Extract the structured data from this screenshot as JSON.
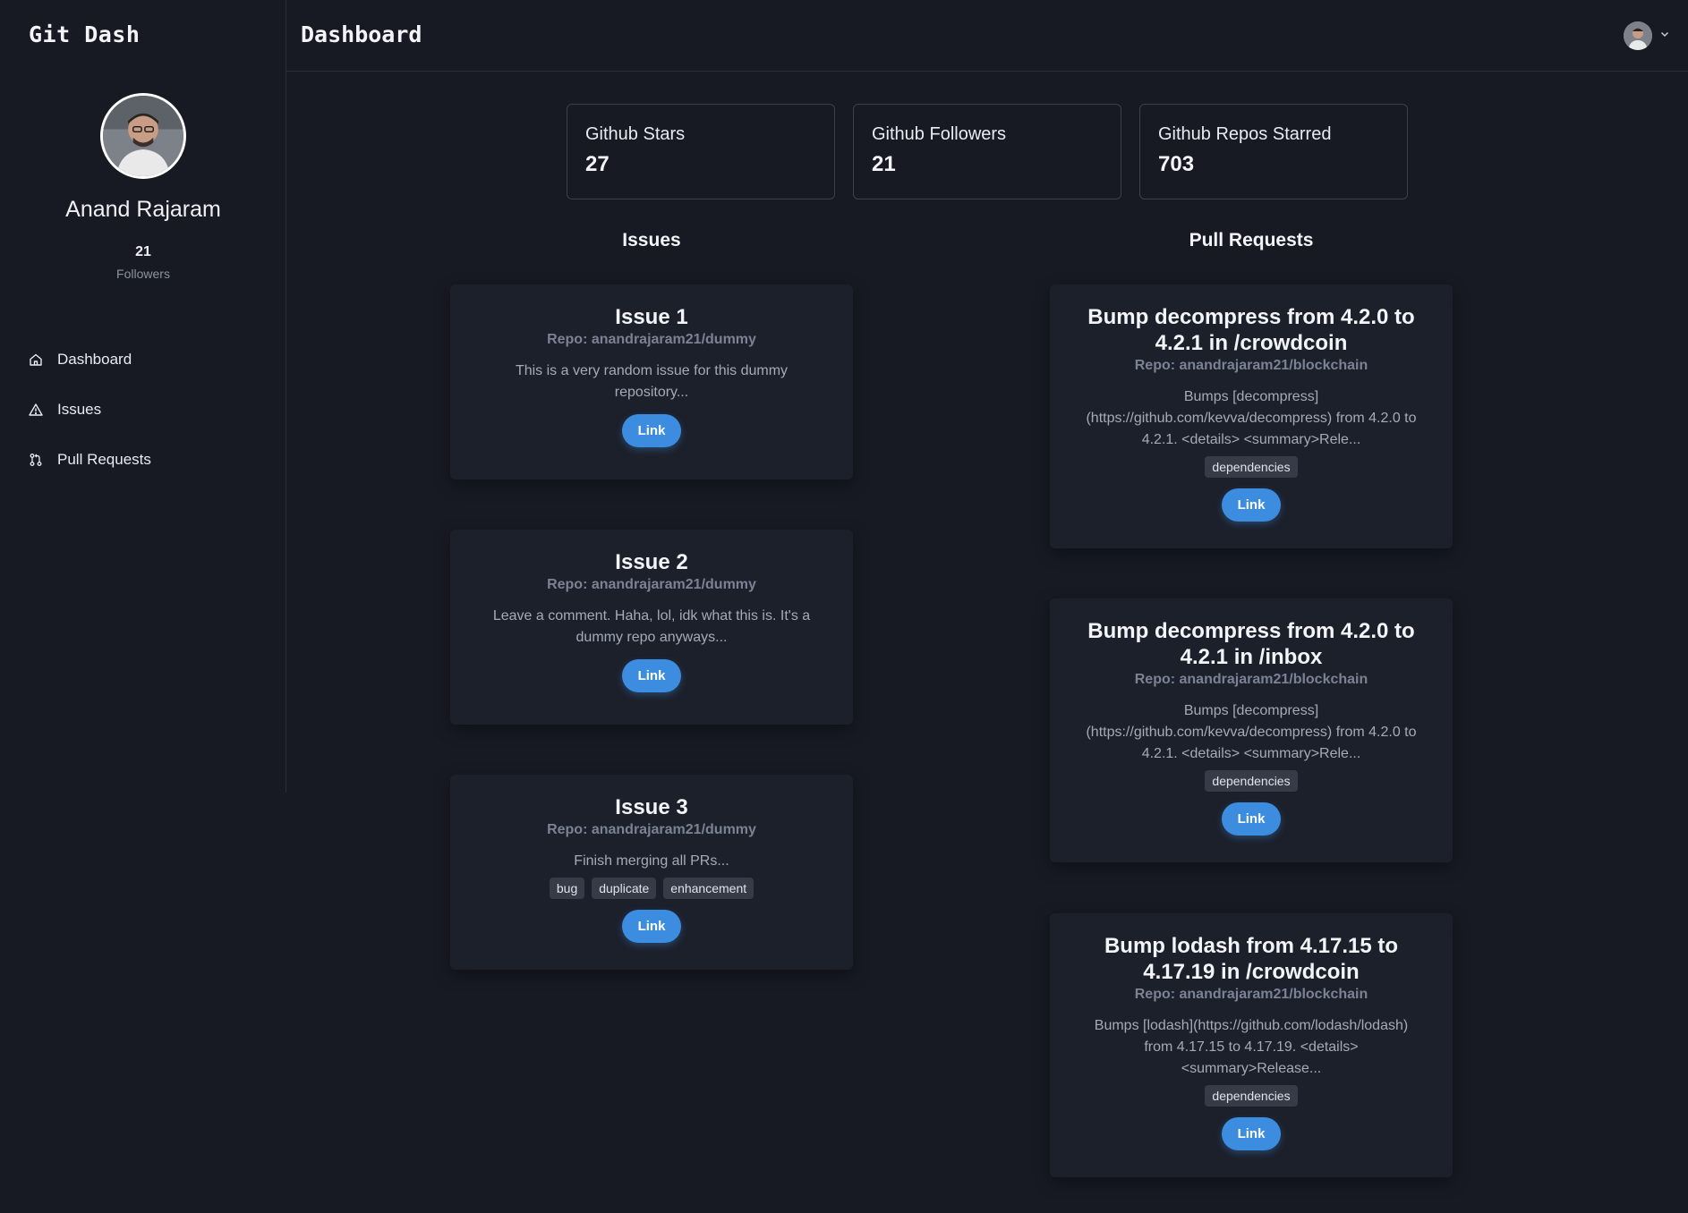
{
  "app": {
    "brand": "Git Dash"
  },
  "profile": {
    "name": "Anand Rajaram",
    "followers_count": "21",
    "followers_label": "Followers"
  },
  "nav": {
    "items": [
      {
        "label": "Dashboard",
        "icon": "home-icon"
      },
      {
        "label": "Issues",
        "icon": "warning-triangle-icon"
      },
      {
        "label": "Pull Requests",
        "icon": "git-pull-request-icon"
      }
    ]
  },
  "header": {
    "title": "Dashboard"
  },
  "stats": [
    {
      "label": "Github Stars",
      "value": "27"
    },
    {
      "label": "Github Followers",
      "value": "21"
    },
    {
      "label": "Github Repos Starred",
      "value": "703"
    }
  ],
  "issues": {
    "heading": "Issues",
    "items": [
      {
        "title": "Issue 1",
        "repo": "Repo: anandrajaram21/dummy",
        "body": "This is a very random issue for this dummy repository...",
        "tags": [],
        "link_label": "Link"
      },
      {
        "title": "Issue 2",
        "repo": "Repo: anandrajaram21/dummy",
        "body": "Leave a comment. Haha, lol, idk what this is. It's a dummy repo anyways...",
        "tags": [],
        "link_label": "Link"
      },
      {
        "title": "Issue 3",
        "repo": "Repo: anandrajaram21/dummy",
        "body": "Finish merging all PRs...",
        "tags": [
          "bug",
          "duplicate",
          "enhancement"
        ],
        "link_label": "Link"
      }
    ]
  },
  "pull_requests": {
    "heading": "Pull Requests",
    "items": [
      {
        "title": "Bump decompress from 4.2.0 to 4.2.1 in /crowdcoin",
        "repo": "Repo: anandrajaram21/blockchain",
        "body": "Bumps [decompress](https://github.com/kevva/decompress) from 4.2.0 to 4.2.1. <details> <summary>Rele...",
        "tags": [
          "dependencies"
        ],
        "link_label": "Link"
      },
      {
        "title": "Bump decompress from 4.2.0 to 4.2.1 in /inbox",
        "repo": "Repo: anandrajaram21/blockchain",
        "body": "Bumps [decompress](https://github.com/kevva/decompress) from 4.2.0 to 4.2.1. <details> <summary>Rele...",
        "tags": [
          "dependencies"
        ],
        "link_label": "Link"
      },
      {
        "title": "Bump lodash from 4.17.15 to 4.17.19 in /crowdcoin",
        "repo": "Repo: anandrajaram21/blockchain",
        "body": "Bumps [lodash](https://github.com/lodash/lodash) from 4.17.15 to 4.17.19. <details> <summary>Release...",
        "tags": [
          "dependencies"
        ],
        "link_label": "Link"
      }
    ]
  },
  "colors": {
    "background": "#171a23",
    "card": "#1c202b",
    "accent": "#3c8de0",
    "muted": "#7b8393"
  }
}
